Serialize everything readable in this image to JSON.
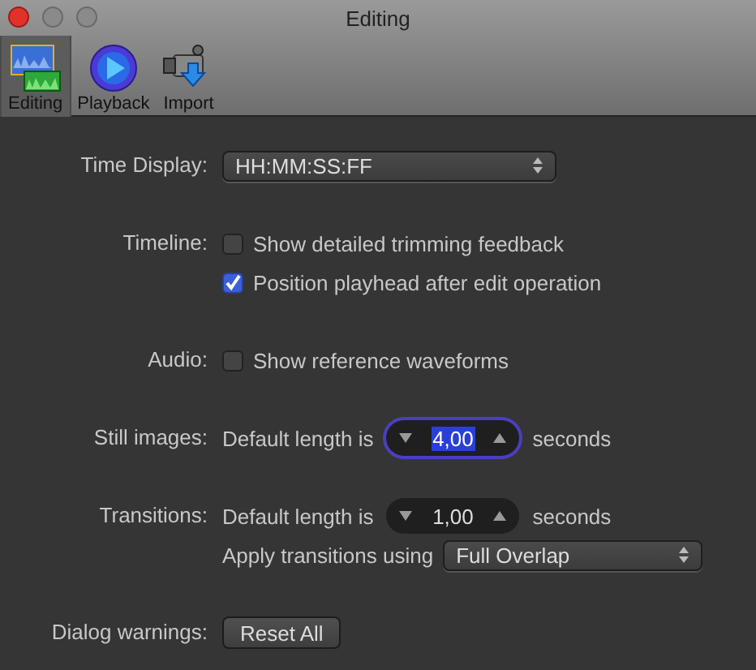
{
  "window": {
    "title": "Editing"
  },
  "toolbar": [
    {
      "label": "Editing",
      "kind": "editing",
      "selected": true
    },
    {
      "label": "Playback",
      "kind": "playback",
      "selected": false
    },
    {
      "label": "Import",
      "kind": "import",
      "selected": false
    }
  ],
  "sections": [
    {
      "label": "Time Display:",
      "rows": [
        {
          "kind": "select",
          "value": "HH:MM:SS:FF"
        }
      ]
    },
    {
      "label": "Timeline:",
      "rows": [
        {
          "kind": "checkbox",
          "text": "Show detailed trimming feedback",
          "checked": false
        },
        {
          "kind": "checkbox",
          "text": "Position playhead after edit operation",
          "checked": true
        }
      ]
    },
    {
      "label": "Audio:",
      "rows": [
        {
          "kind": "checkbox",
          "text": "Show reference waveforms",
          "checked": false
        }
      ]
    },
    {
      "label": "Still images:",
      "rows": [
        {
          "kind": "stepper",
          "prefix": "Default length is",
          "value": "4,00",
          "suffix": "seconds",
          "focused": true
        }
      ]
    },
    {
      "label": "Transitions:",
      "rows": [
        {
          "kind": "stepper",
          "prefix": "Default length is",
          "value": "1,00",
          "suffix": "seconds",
          "focused": false
        },
        {
          "kind": "labeled-select",
          "prefix": "Apply transitions using",
          "value": "Full Overlap"
        }
      ]
    },
    {
      "label": "Dialog warnings:",
      "rows": [
        {
          "kind": "button",
          "text": "Reset All"
        }
      ]
    }
  ]
}
